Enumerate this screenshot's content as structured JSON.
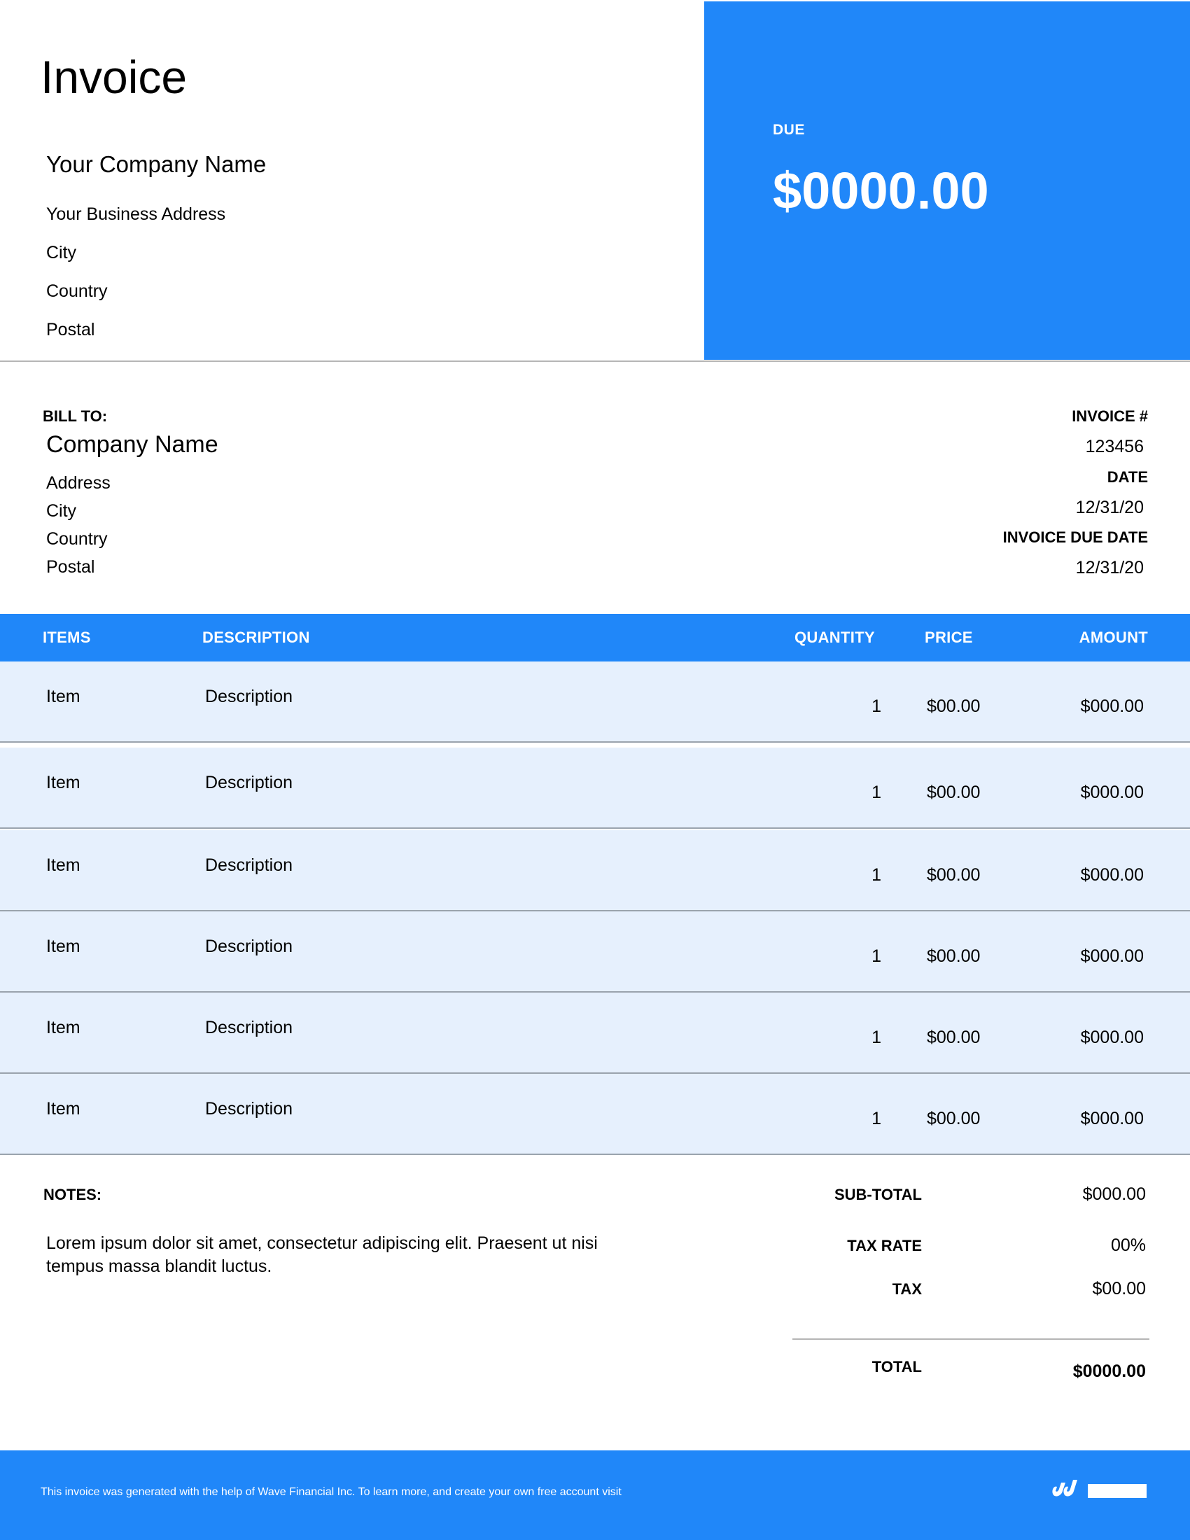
{
  "header": {
    "title": "Invoice",
    "company_name": "Your Company Name",
    "address": "Your Business Address",
    "city": "City",
    "country": "Country",
    "postal": "Postal"
  },
  "due": {
    "label": "DUE",
    "amount": "$0000.00"
  },
  "bill_to": {
    "label": "BILL TO:",
    "company_name": "Company Name",
    "address": "Address",
    "city": "City",
    "country": "Country",
    "postal": "Postal"
  },
  "meta": {
    "invoice_no_label": "INVOICE #",
    "invoice_no": "123456",
    "date_label": "DATE",
    "date": "12/31/20",
    "due_date_label": "INVOICE DUE DATE",
    "due_date": "12/31/20"
  },
  "table": {
    "headers": {
      "items": "ITEMS",
      "description": "DESCRIPTION",
      "quantity": "QUANTITY",
      "price": "PRICE",
      "amount": "AMOUNT"
    },
    "rows": [
      {
        "item": "Item",
        "description": "Description",
        "quantity": "1",
        "price": "$00.00",
        "amount": "$000.00"
      },
      {
        "item": "Item",
        "description": "Description",
        "quantity": "1",
        "price": "$00.00",
        "amount": "$000.00"
      },
      {
        "item": "Item",
        "description": "Description",
        "quantity": "1",
        "price": "$00.00",
        "amount": "$000.00"
      },
      {
        "item": "Item",
        "description": "Description",
        "quantity": "1",
        "price": "$00.00",
        "amount": "$000.00"
      },
      {
        "item": "Item",
        "description": "Description",
        "quantity": "1",
        "price": "$00.00",
        "amount": "$000.00"
      },
      {
        "item": "Item",
        "description": "Description",
        "quantity": "1",
        "price": "$00.00",
        "amount": "$000.00"
      }
    ]
  },
  "notes": {
    "label": "NOTES:",
    "text": "Lorem ipsum dolor sit amet, consectetur adipiscing elit. Praesent ut nisi tempus massa blandit luctus."
  },
  "totals": {
    "subtotal_label": "SUB-TOTAL",
    "subtotal": "$000.00",
    "tax_rate_label": "TAX RATE",
    "tax_rate": "00%",
    "tax_label": "TAX",
    "tax": "$00.00",
    "total_label": "TOTAL",
    "total": "$0000.00"
  },
  "footer": {
    "text": "This invoice was generated with the help of Wave Financial Inc. To learn more, and create your own free account visit",
    "logo_icon": "wave-logo-icon"
  },
  "colors": {
    "accent": "#2087f9",
    "row_bg": "#e6f0fd"
  }
}
